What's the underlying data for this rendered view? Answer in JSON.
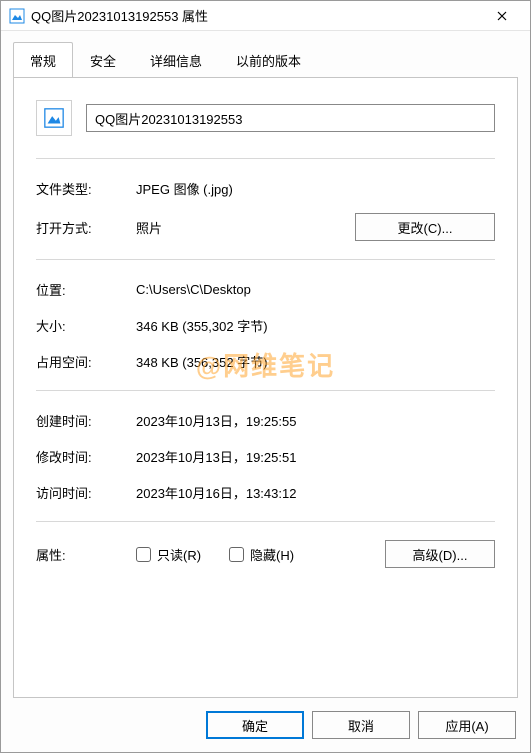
{
  "window": {
    "title": "QQ图片20231013192553 属性"
  },
  "tabs": {
    "general": "常规",
    "security": "安全",
    "details": "详细信息",
    "previous": "以前的版本"
  },
  "filename": "QQ图片20231013192553",
  "labels": {
    "filetype": "文件类型:",
    "opens_with": "打开方式:",
    "location": "位置:",
    "size": "大小:",
    "size_on_disk": "占用空间:",
    "created": "创建时间:",
    "modified": "修改时间:",
    "accessed": "访问时间:",
    "attributes": "属性:"
  },
  "values": {
    "filetype": "JPEG 图像 (.jpg)",
    "opens_with": "照片",
    "location": "C:\\Users\\C\\Desktop",
    "size": "346 KB (355,302 字节)",
    "size_on_disk": "348 KB (356,352 字节)",
    "created": "2023年10月13日，19:25:55",
    "modified": "2023年10月13日，19:25:51",
    "accessed": "2023年10月16日，13:43:12"
  },
  "buttons": {
    "change": "更改(C)...",
    "advanced": "高级(D)...",
    "ok": "确定",
    "cancel": "取消",
    "apply": "应用(A)"
  },
  "checkboxes": {
    "readonly": "只读(R)",
    "hidden": "隐藏(H)"
  },
  "watermark": "@网维笔记"
}
